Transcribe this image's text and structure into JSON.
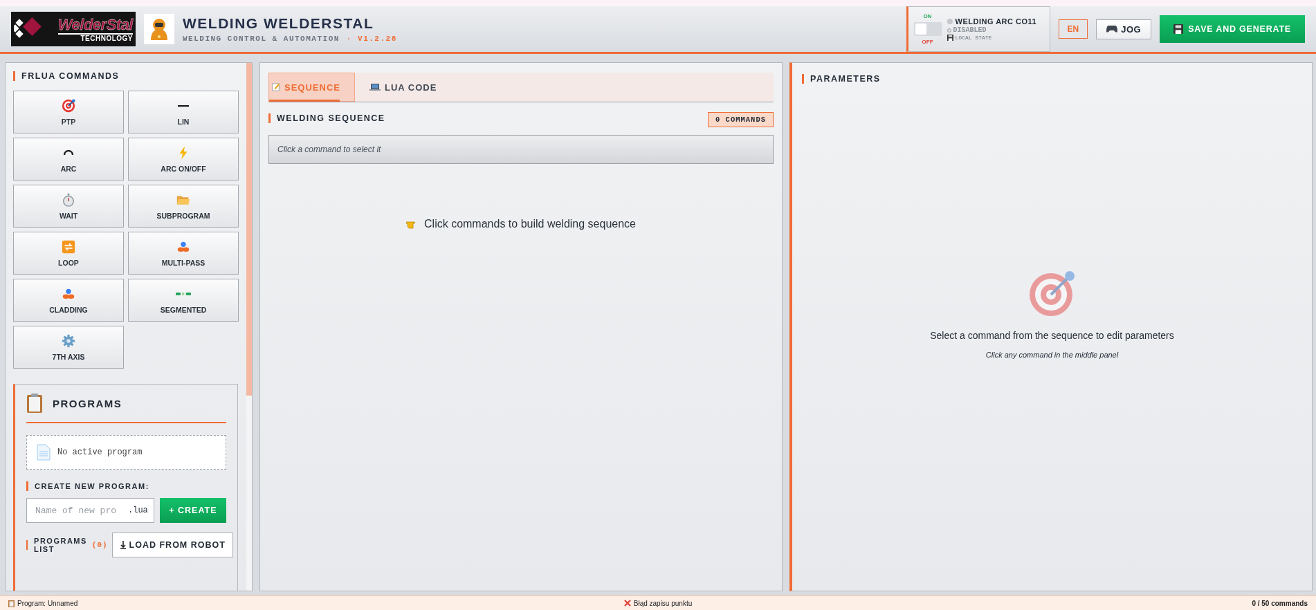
{
  "header": {
    "logo": {
      "brand": "WelderStal",
      "tagline": "TECHNOLOGY"
    },
    "title": "WELDING WELDERSTAL",
    "subtitle": "WELDING CONTROL & AUTOMATION",
    "version": "· V1.2.28",
    "arc": {
      "on_label": "ON",
      "off_label": "OFF",
      "on": false,
      "name": "WELDING ARC CO11",
      "status": "DISABLED",
      "storage": "LOCAL STATE"
    },
    "language": "EN",
    "jog": "JOG",
    "save": "SAVE AND GENERATE"
  },
  "commands": {
    "title": "FRLUA COMMANDS",
    "items": [
      {
        "label": "PTP"
      },
      {
        "label": "LIN"
      },
      {
        "label": "ARC"
      },
      {
        "label": "ARC ON/OFF"
      },
      {
        "label": "WAIT"
      },
      {
        "label": "SUBPROGRAM"
      },
      {
        "label": "LOOP"
      },
      {
        "label": "MULTI-PASS"
      },
      {
        "label": "CLADDING"
      },
      {
        "label": "SEGMENTED"
      },
      {
        "label": "7TH AXIS"
      }
    ]
  },
  "programs": {
    "title": "PROGRAMS",
    "empty": "No active program",
    "create_label": "CREATE NEW PROGRAM:",
    "name_placeholder": "Name of new pro",
    "suffix": ".lua",
    "create": "+ CREATE",
    "list_label": "PROGRAMS LIST",
    "count": "(0)",
    "load": "LOAD FROM ROBOT"
  },
  "sequence": {
    "tabs": [
      {
        "label": "SEQUENCE",
        "selected": true
      },
      {
        "label": "LUA CODE",
        "selected": false
      }
    ],
    "title": "WELDING SEQUENCE",
    "count": "0 COMMANDS",
    "hint": "Click a command to select it",
    "empty": "Click commands to build welding sequence"
  },
  "parameters": {
    "title": "PARAMETERS",
    "empty": "Select a command from the sequence to edit parameters",
    "empty_hint": "Click any command in the middle panel"
  },
  "status_bar": {
    "program": "Program: Unnamed",
    "error": "Błąd zapisu punktu",
    "commands": "0 / 50 commands"
  }
}
